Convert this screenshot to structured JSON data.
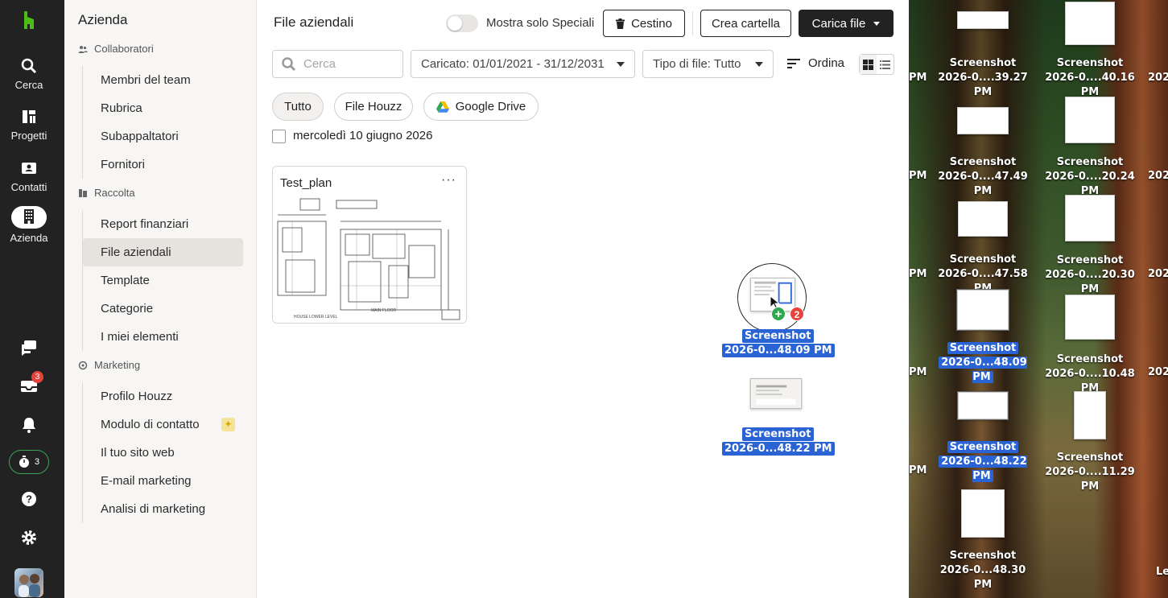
{
  "rail": {
    "items": [
      {
        "label": "Cerca",
        "icon": "search-icon"
      },
      {
        "label": "Progetti",
        "icon": "projects-icon"
      },
      {
        "label": "Contatti",
        "icon": "contacts-icon"
      },
      {
        "label": "Azienda",
        "icon": "company-icon"
      }
    ],
    "messages_badge": "3",
    "timer_count": "3"
  },
  "sidebar": {
    "title": "Azienda",
    "sections": [
      {
        "label": "Collaboratori",
        "items": [
          "Membri del team",
          "Rubrica",
          "Subappaltatori",
          "Fornitori"
        ]
      },
      {
        "label": "Raccolta",
        "items": [
          "Report finanziari",
          "File aziendali",
          "Template",
          "Categorie",
          "I miei elementi"
        ]
      },
      {
        "label": "Marketing",
        "items": [
          "Profilo Houzz",
          "Modulo di contatto",
          "Il tuo sito web",
          "E-mail marketing",
          "Analisi di marketing"
        ]
      }
    ],
    "selected": "File aziendali"
  },
  "main": {
    "title": "File aziendali",
    "toggle_label": "Mostra solo Speciali",
    "trash_label": "Cestino",
    "new_folder_label": "Crea cartella",
    "upload_label": "Carica file",
    "search_placeholder": "Cerca",
    "date_filter": "Caricato: 01/01/2021 - 31/12/2031",
    "type_filter": "Tipo di file: Tutto",
    "sort_label": "Ordina",
    "chips": [
      "Tutto",
      "File Houzz",
      "Google Drive"
    ],
    "date_group": "mercoledì 10 giugno 2026",
    "files": [
      {
        "name": "Test_plan",
        "more": "···"
      }
    ]
  },
  "drag": {
    "count": "2",
    "items": [
      {
        "line1": "Screenshot",
        "line2": "2026-0...48.09 PM"
      },
      {
        "line1": "Screenshot",
        "line2": "2026-0...48.22 PM"
      }
    ]
  },
  "desktop": {
    "icons": [
      {
        "line1": "Screenshot",
        "line2": "2026-0....39.27 PM"
      },
      {
        "line1": "Screenshot",
        "line2": "2026-0....40.16 PM"
      },
      {
        "line1": "Screenshot",
        "line2": "2026-0....47.49 PM"
      },
      {
        "line1": "Screenshot",
        "line2": "2026-0....20.24 PM"
      },
      {
        "line1": "Screenshot",
        "line2": "2026-0....47.58 PM"
      },
      {
        "line1": "Screenshot",
        "line2": "2026-0....20.30 PM"
      },
      {
        "line1": "Screenshot",
        "line2": "2026-0...48.09 PM"
      },
      {
        "line1": "Screenshot",
        "line2": "2026-0....10.48 PM"
      },
      {
        "line1": "Screenshot",
        "line2": "2026-0...48.22 PM"
      },
      {
        "line1": "Screenshot",
        "line2": "2026-0....11.29 PM"
      },
      {
        "line1": "Screenshot",
        "line2": "2026-0...48.30 PM"
      }
    ],
    "edge_left": "PM",
    "edge_right": "202",
    "edge_right_bottom": "Le"
  }
}
